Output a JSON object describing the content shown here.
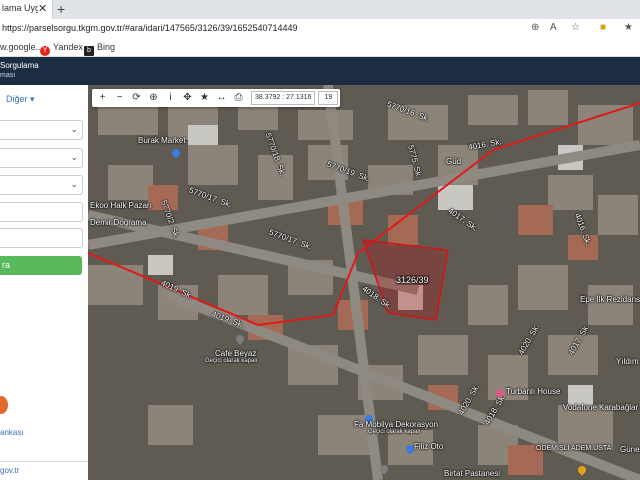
{
  "browser": {
    "tab_title": "Parsel Sorgulama Uygula",
    "tab_title_visible": "lama Uygula",
    "tab_close": "✕",
    "new_tab": "+",
    "url": "https://parselsorgu.tkgm.gov.tr/#ara/idari/147565/3126/39/1652540714449",
    "bookmarks": [
      {
        "label": "w.google..."
      },
      {
        "label": "Yandex"
      },
      {
        "label": "Bing"
      }
    ]
  },
  "site": {
    "brand_line1": "Sorgulama",
    "brand_line2": "ması"
  },
  "sidebar": {
    "other_menu": "Diğer",
    "search_button": "ra",
    "bank_link": "ankası",
    "gov_link": "gov.tr"
  },
  "map": {
    "toolbar": {
      "coordinates": "38.3792 : 27.1316",
      "zoom": "19"
    },
    "parcel_label": "3126/39",
    "street_labels": [
      "5770/16. Sk.",
      "5770/18. Sk.",
      "5770/19. Sk.",
      "5770/17. Sk.",
      "5770/2. Sk.",
      "5770/17. Sk.",
      "4016. Sk.",
      "4017. Sk.",
      "4016. Sk.",
      "4018. Sk.",
      "4019. Sk.",
      "4019. Sk.",
      "4020. Sk.",
      "4017. Sk.",
      "4020. Sk.",
      "4018. Sk.",
      "5775. Sk."
    ],
    "places": [
      {
        "name": "Burak Market"
      },
      {
        "name": "Ekoo Halk Pazarı"
      },
      {
        "name": "Demir Doğrama"
      },
      {
        "name": "Cafe Beyaz"
      },
      {
        "name": "Geçici olarak kapalı"
      },
      {
        "name": "Turbanlı House"
      },
      {
        "name": "Fa Mobilya Dekorasyon"
      },
      {
        "name": "Geçici olarak kapalı"
      },
      {
        "name": "Vodafone Karabağlar"
      },
      {
        "name": "Epe İlk Rezidans"
      },
      {
        "name": "Yıldım"
      },
      {
        "name": "Filiz Oto"
      },
      {
        "name": "Birtat Pastanesi"
      },
      {
        "name": "ÖDEMİŞLİ ADEM USTA"
      },
      {
        "name": "Güd"
      },
      {
        "name": "Güne"
      }
    ]
  }
}
